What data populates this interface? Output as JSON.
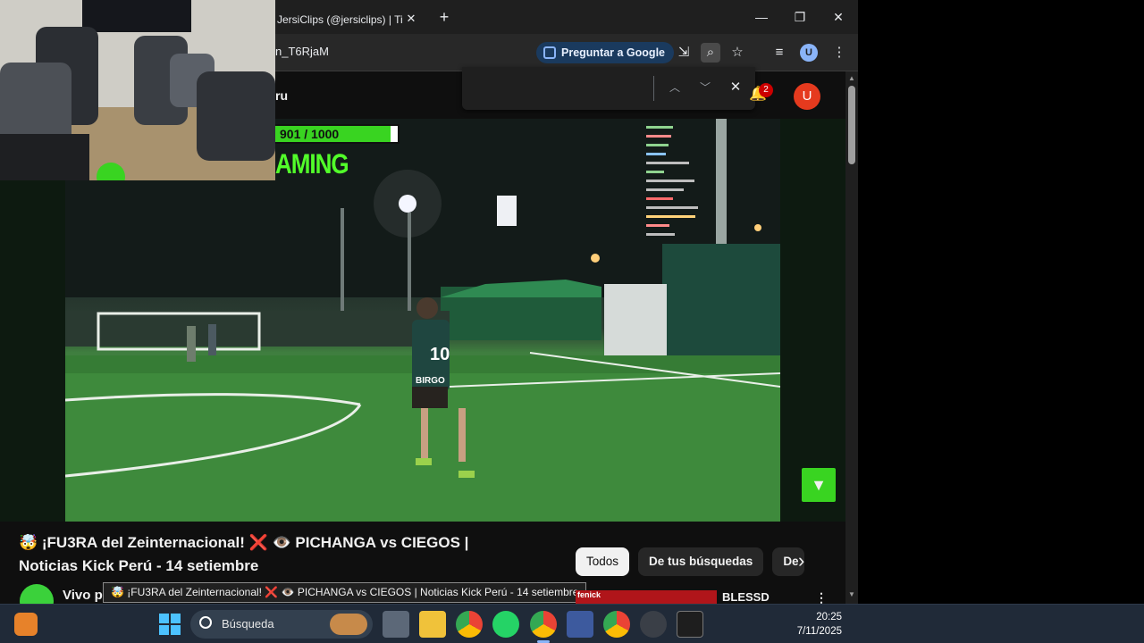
{
  "browser": {
    "tab_title": "JersiClips (@jersiclips) | TikTok",
    "tab_close": "✕",
    "new_tab": "+",
    "url_fragment": "n_T6RjaM",
    "ask_google_label": "Preguntar a Google",
    "window_controls": {
      "minimize": "—",
      "maximize": "❐",
      "close": "✕"
    }
  },
  "youtube": {
    "search_text": "ru",
    "notifications_count": "2",
    "avatar_letter": "U",
    "findbar": {
      "prev": "︿",
      "next": "﹀",
      "close": "✕"
    }
  },
  "overlay": {
    "goal_counter": "901 / 1000",
    "gaming_text": "AMING",
    "jersey_number": "10",
    "jersey_sponsor": "BIRGO"
  },
  "video": {
    "title": "🤯 ¡FU3RA del Zeinternacional! ❌ 👁️ PICHANGA vs CIEGOS | Noticias Kick Perú - 14 setiembre",
    "channel_name": "Vivo po",
    "tooltip": "🤯 ¡FU3RA del Zeinternacional! ❌ 👁️ PICHANGA vs CIEGOS | Noticias Kick Perú - 14 setiembre"
  },
  "chips": {
    "items": [
      "Todos",
      "De tus búsquedas",
      "De"
    ],
    "next": "›"
  },
  "recommendation": {
    "thumb_text": "fenick",
    "title": "BLESSD",
    "more": "⋮"
  },
  "taskbar": {
    "search_placeholder": "Búsqueda",
    "time": "20:25",
    "date": "7/11/2025"
  },
  "colors": {
    "accent_blue": "#8ab4f8",
    "yt_red": "#cc0000",
    "avatar_orange": "#e53a1e",
    "pitch_green": "#3f8a3e"
  }
}
